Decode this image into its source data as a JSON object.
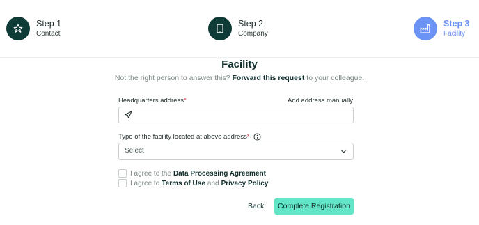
{
  "stepper": {
    "steps": [
      {
        "title": "Step 1",
        "subtitle": "Contact",
        "icon": "star-icon",
        "state": "done"
      },
      {
        "title": "Step 2",
        "subtitle": "Company",
        "icon": "building-icon",
        "state": "done"
      },
      {
        "title": "Step 3",
        "subtitle": "Facility",
        "icon": "factory-icon",
        "state": "active"
      }
    ]
  },
  "form": {
    "heading": "Facility",
    "subline": {
      "before": "Not the right person to answer this?",
      "link": "Forward this request",
      "after": "to your colleague."
    },
    "address": {
      "label": "Headquarters address",
      "required_mark": "*",
      "manual_link": "Add address manually",
      "value": "",
      "icon": "navigation-arrow-icon"
    },
    "facility_type": {
      "label": "Type of the facility located at above address",
      "required_mark": "*",
      "info_icon": "info-icon",
      "selected": "Select"
    },
    "agreements": {
      "dpa": {
        "prefix": "I agree to the",
        "link": "Data Processing Agreement",
        "checked": false
      },
      "terms": {
        "prefix": "I agree to",
        "link1": "Terms of Use",
        "middle": "and",
        "link2": "Privacy Policy",
        "checked": false
      }
    },
    "actions": {
      "back": "Back",
      "complete": "Complete Registration"
    }
  },
  "colors": {
    "primary_dark": "#0f3b36",
    "active_step": "#6b93f5",
    "cta": "#62e6c7",
    "required": "#d9363e"
  }
}
